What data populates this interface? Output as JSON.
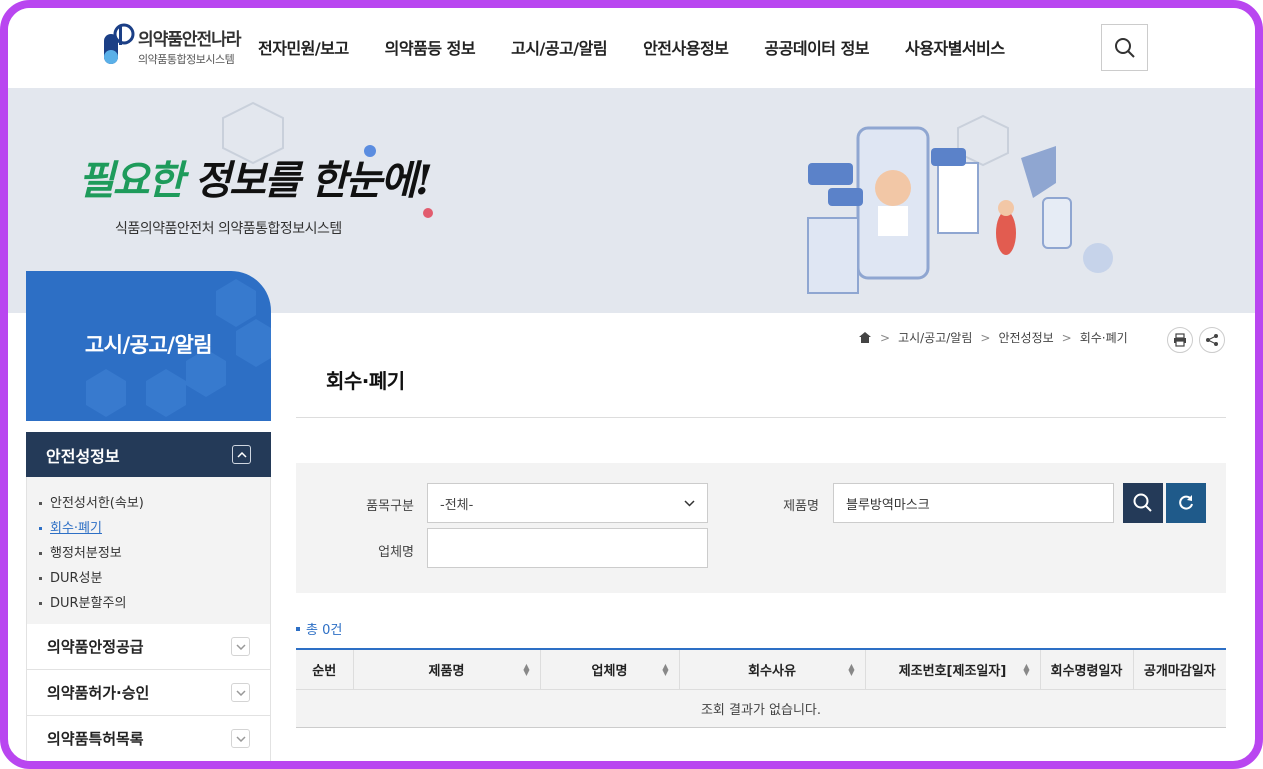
{
  "header": {
    "logo_title": "의약품안전나라",
    "logo_subtitle": "의약품통합정보시스템",
    "nav": [
      "전자민원/보고",
      "의약품등 정보",
      "고시/공고/알림",
      "안전사용정보",
      "공공데이터 정보",
      "사용자별서비스"
    ]
  },
  "banner": {
    "title_a": "필요한 ",
    "title_b": "정보",
    "title_c": "를 한눈에!",
    "subtitle": "식품의약품안전처 의약품통합정보시스템"
  },
  "sidebar": {
    "heading": "고시/공고/알림",
    "open_group": "안전성정보",
    "sub_items": [
      "안전성서한(속보)",
      "회수·폐기",
      "행정처분정보",
      "DUR성분",
      "DUR분할주의"
    ],
    "active_index": 1,
    "groups": [
      "의약품안정공급",
      "의약품허가·승인",
      "의약품특허목록"
    ]
  },
  "breadcrumb": [
    "고시/공고/알림",
    "안전성정보",
    "회수·폐기"
  ],
  "page_title": "회수·폐기",
  "search": {
    "category_label": "품목구분",
    "category_value": "-전체-",
    "product_label": "제품명",
    "product_value": "블루방역마스크",
    "company_label": "업체명",
    "company_value": ""
  },
  "results": {
    "total": "총 0건",
    "columns": [
      "순번",
      "제품명",
      "업체명",
      "회수사유",
      "제조번호[제조일자]",
      "회수명령일자",
      "공개마감일자"
    ],
    "empty_message": "조회 결과가 없습니다."
  },
  "colors": {
    "accent": "#2d6fc5",
    "navy": "#243a58",
    "frame": "#b946f0"
  }
}
